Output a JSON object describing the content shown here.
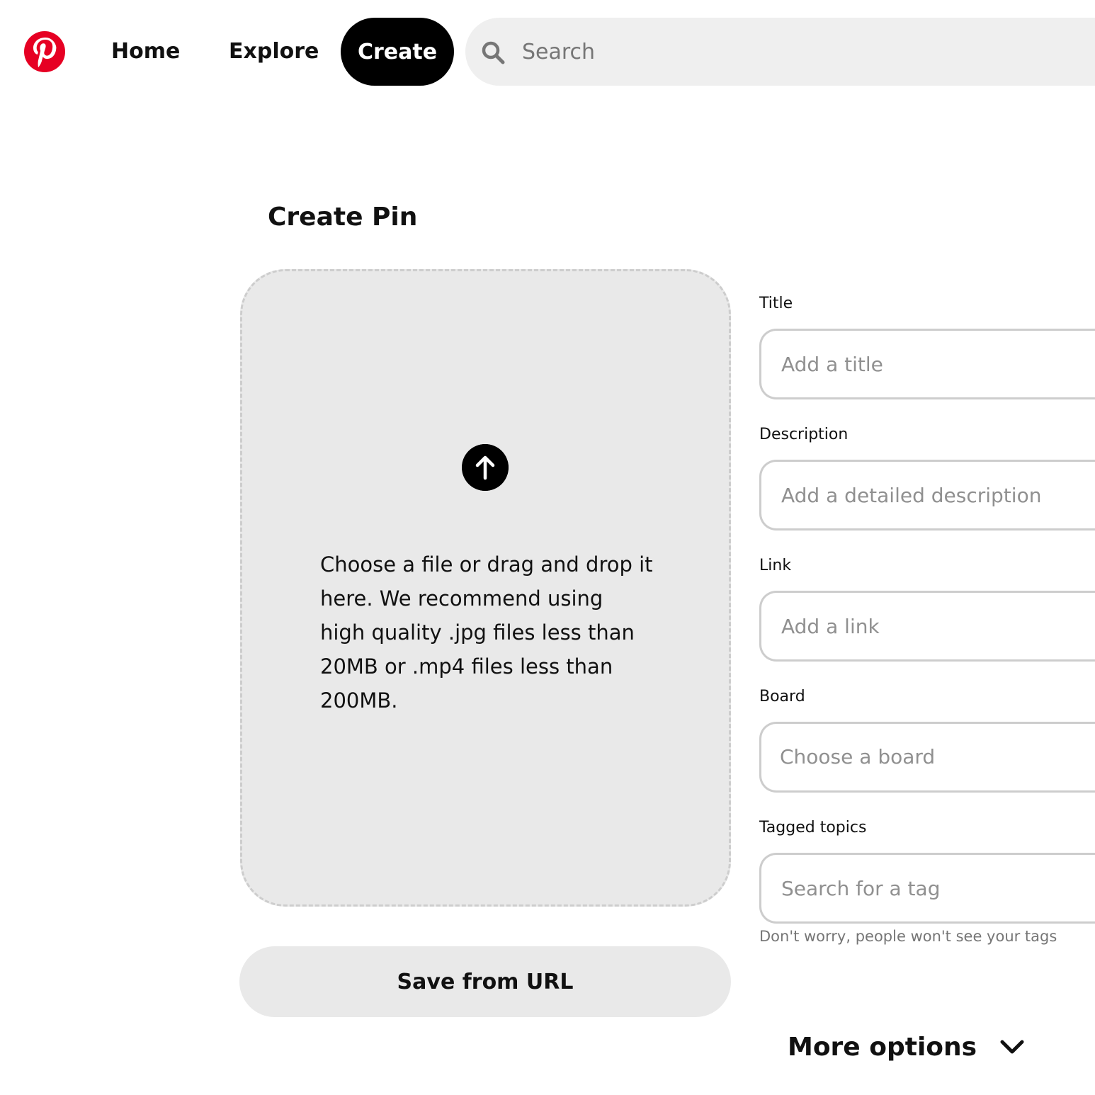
{
  "nav": {
    "logo": "pinterest-logo",
    "home_label": "Home",
    "explore_label": "Explore",
    "create_label": "Create",
    "search_placeholder": "Search"
  },
  "page": {
    "title": "Create Pin"
  },
  "upload": {
    "instructions": "Choose a file or drag and drop it here. We recommend using high quality .jpg files less than 20MB or .mp4 files less than 200MB.",
    "save_from_url_label": "Save from URL"
  },
  "form": {
    "title_label": "Title",
    "title_placeholder": "Add a title",
    "description_label": "Description",
    "description_placeholder": "Add a detailed description",
    "link_label": "Link",
    "link_placeholder": "Add a link",
    "board_label": "Board",
    "board_placeholder": "Choose a board",
    "topics_label": "Tagged topics",
    "topics_placeholder": "Search for a tag",
    "topics_helper": "Don't worry, people won't see your tags",
    "more_options_label": "More options"
  },
  "colors": {
    "brand": "#e60023",
    "accent": "#000000",
    "surface": "#e9e9e9"
  }
}
